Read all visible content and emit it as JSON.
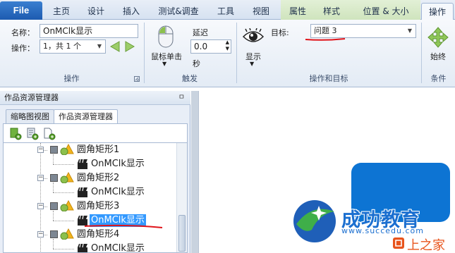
{
  "ribbon_tabs": {
    "file": "File",
    "home": "主页",
    "design": "设计",
    "insert": "插入",
    "test_debug": "测试&调查",
    "tools": "工具",
    "view": "视图",
    "properties": "属性",
    "style": "样式",
    "position_size": "位置 & 大小",
    "actions": "操作"
  },
  "actions_group": {
    "name_label": "名称：",
    "name_value": "OnMClk显示",
    "action_label": "操作：",
    "action_value": "1，共 1 个",
    "group_title": "操作"
  },
  "trigger_group": {
    "trigger_name": "鼠标单击",
    "delay_label": "延迟",
    "delay_value": "0.0",
    "unit_seconds": "秒",
    "group_title": "触发"
  },
  "target_group": {
    "action_name": "显示",
    "target_label": "目标:",
    "target_value": "问题 3",
    "group_title": "操作和目标"
  },
  "condition_group": {
    "always_label": "始终",
    "group_title": "条件"
  },
  "explorer": {
    "pane_title": "作品资源管理器",
    "pin_glyph": "ㅁ",
    "tab_thumbnail": "缩略图视图",
    "tab_explorer": "作品资源管理器",
    "nodes": [
      {
        "label": "圆角矩形1",
        "child": "OnMClk显示",
        "child_selected": false
      },
      {
        "label": "圆角矩形2",
        "child": "OnMClk显示",
        "child_selected": false
      },
      {
        "label": "圆角矩形3",
        "child": "OnMClk显示",
        "child_selected": true
      },
      {
        "label": "圆角矩形4",
        "child": "OnMClk显示",
        "child_selected": false
      }
    ]
  },
  "watermark": {
    "brand_cn": "成功教育",
    "url": "www.succedu.com",
    "corner_text": "上之家"
  },
  "colors": {
    "accent_blue": "#0d74d3",
    "file_tab": "#1d5bb0",
    "annotation_red": "#e0141a",
    "selection": "#3399ff"
  }
}
